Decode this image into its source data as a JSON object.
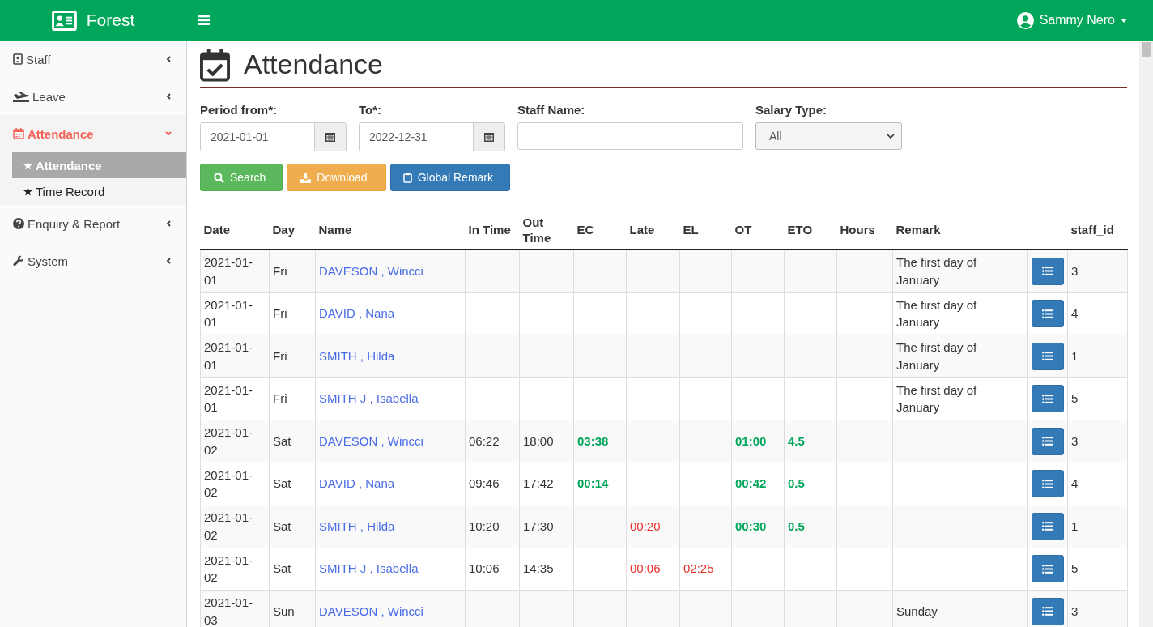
{
  "header": {
    "brand": "Forest",
    "user": "Sammy Nero"
  },
  "sidebar": {
    "items": [
      {
        "label": "Staff",
        "expanded": false
      },
      {
        "label": "Leave",
        "expanded": false
      },
      {
        "label": "Attendance",
        "expanded": true,
        "children": [
          {
            "label": "Attendance",
            "selected": true
          },
          {
            "label": "Time Record",
            "selected": false
          }
        ]
      },
      {
        "label": "Enquiry & Report",
        "expanded": false
      },
      {
        "label": "System",
        "expanded": false
      }
    ]
  },
  "page": {
    "title": "Attendance"
  },
  "filters": {
    "period_from": {
      "label": "Period from*:",
      "value": "2021-01-01"
    },
    "to": {
      "label": "To*:",
      "value": "2022-12-31"
    },
    "staff_name": {
      "label": "Staff Name:"
    },
    "salary_type": {
      "label": "Salary Type:",
      "value": "All"
    }
  },
  "buttons": [
    {
      "label": "Search",
      "kind": "search"
    },
    {
      "label": "Download",
      "kind": "download"
    },
    {
      "label": "Global Remark",
      "kind": "remark"
    }
  ],
  "table": {
    "columns": [
      "Date",
      "Day",
      "Name",
      "In Time",
      "Out Time",
      "EC",
      "Late",
      "EL",
      "OT",
      "ETO",
      "Hours",
      "Remark",
      "staff_id"
    ],
    "rows": [
      {
        "date": "2021-01-01",
        "day": "Fri",
        "name": "DAVESON , Wincci",
        "remark": "The first day of January",
        "staff_id": "3"
      },
      {
        "date": "2021-01-01",
        "day": "Fri",
        "name": "DAVID , Nana",
        "remark": "The first day of January",
        "staff_id": "4"
      },
      {
        "date": "2021-01-01",
        "day": "Fri",
        "name": "SMITH , Hilda",
        "remark": "The first day of January",
        "staff_id": "1"
      },
      {
        "date": "2021-01-01",
        "day": "Fri",
        "name": "SMITH J , Isabella",
        "remark": "The first day of January",
        "staff_id": "5"
      },
      {
        "date": "2021-01-02",
        "day": "Sat",
        "name": "DAVESON , Wincci",
        "in_time": "06:22",
        "out_time": "18:00",
        "ec": "03:38",
        "ot": "01:00",
        "eto": "4.5",
        "staff_id": "3"
      },
      {
        "date": "2021-01-02",
        "day": "Sat",
        "name": "DAVID , Nana",
        "in_time": "09:46",
        "out_time": "17:42",
        "ec": "00:14",
        "ot": "00:42",
        "eto": "0.5",
        "staff_id": "4"
      },
      {
        "date": "2021-01-02",
        "day": "Sat",
        "name": "SMITH , Hilda",
        "in_time": "10:20",
        "out_time": "17:30",
        "late": "00:20",
        "ot": "00:30",
        "eto": "0.5",
        "staff_id": "1"
      },
      {
        "date": "2021-01-02",
        "day": "Sat",
        "name": "SMITH J , Isabella",
        "in_time": "10:06",
        "out_time": "14:35",
        "late": "00:06",
        "el": "02:25",
        "staff_id": "5"
      },
      {
        "date": "2021-01-03",
        "day": "Sun",
        "name": "DAVESON , Wincci",
        "remark": "Sunday",
        "staff_id": "3"
      }
    ]
  }
}
